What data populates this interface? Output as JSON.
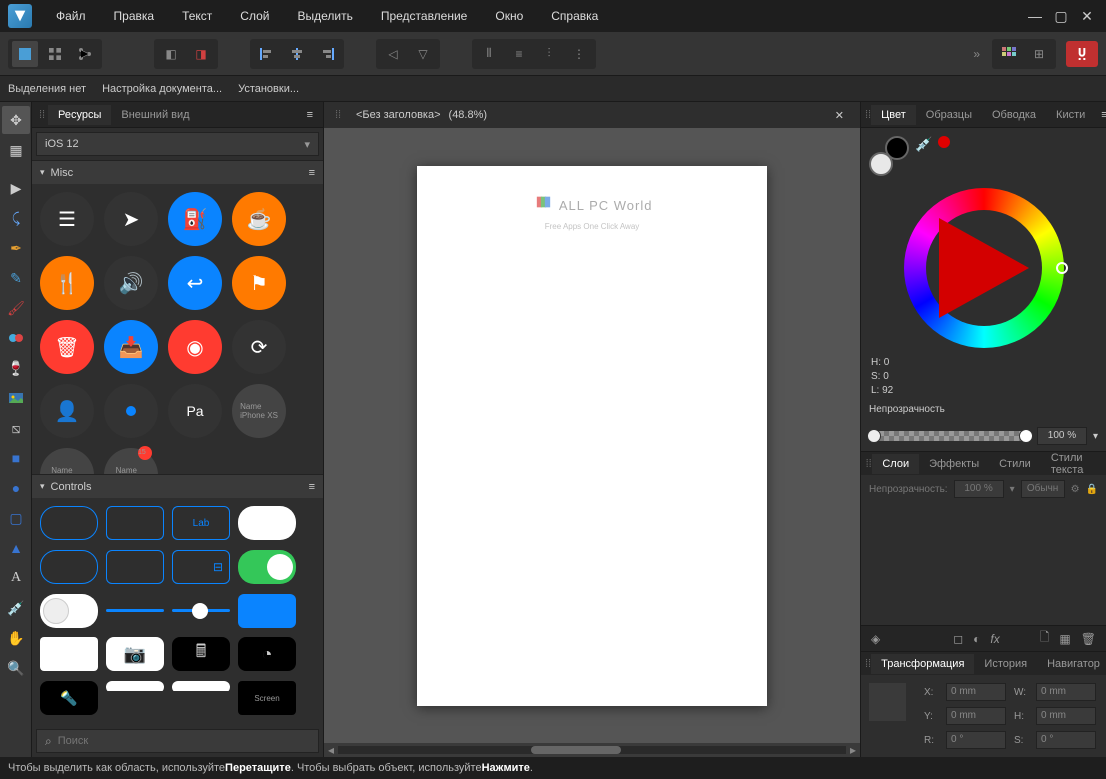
{
  "menu": {
    "items": [
      "Файл",
      "Правка",
      "Текст",
      "Слой",
      "Выделить",
      "Представление",
      "Окно",
      "Справка"
    ]
  },
  "context": {
    "selection": "Выделения нет",
    "doc_setup": "Настройка документа...",
    "prefs": "Установки..."
  },
  "left": {
    "tabs": [
      "Ресурсы",
      "Внешний вид"
    ],
    "preset": "iOS 12",
    "section_misc": "Misc",
    "section_controls": "Controls",
    "search_placeholder": "Поиск",
    "ctrl_label": "Lab"
  },
  "document": {
    "title": "<Без заголовка>",
    "zoom": "(48.8%)"
  },
  "watermark": {
    "text": "ALL PC World",
    "sub": "Free Apps One Click Away"
  },
  "color": {
    "tabs": [
      "Цвет",
      "Образцы",
      "Обводка",
      "Кисти"
    ],
    "h": "H: 0",
    "s": "S: 0",
    "l": "L: 92",
    "opacity_label": "Непрозрачность",
    "opacity_value": "100 %"
  },
  "layers": {
    "tabs": [
      "Слои",
      "Эффекты",
      "Стили",
      "Стили текста"
    ],
    "opacity_label": "Непрозрачность:",
    "opacity_value": "100 %",
    "blend": "Обычн"
  },
  "transform": {
    "tabs": [
      "Трансформация",
      "История",
      "Навигатор"
    ],
    "x_label": "X:",
    "x": "0 mm",
    "y_label": "Y:",
    "y": "0 mm",
    "w_label": "W:",
    "w": "0 mm",
    "h_label": "H:",
    "h": "0 mm",
    "r_label": "R:",
    "r": "0 °",
    "s_label": "S:",
    "s": "0 °"
  },
  "status": {
    "pre1": "Чтобы выделить как область, используйте ",
    "b1": "Перетащите",
    "mid": ". Чтобы выбрать объект, используйте ",
    "b2": "Нажмите",
    "post": "."
  }
}
